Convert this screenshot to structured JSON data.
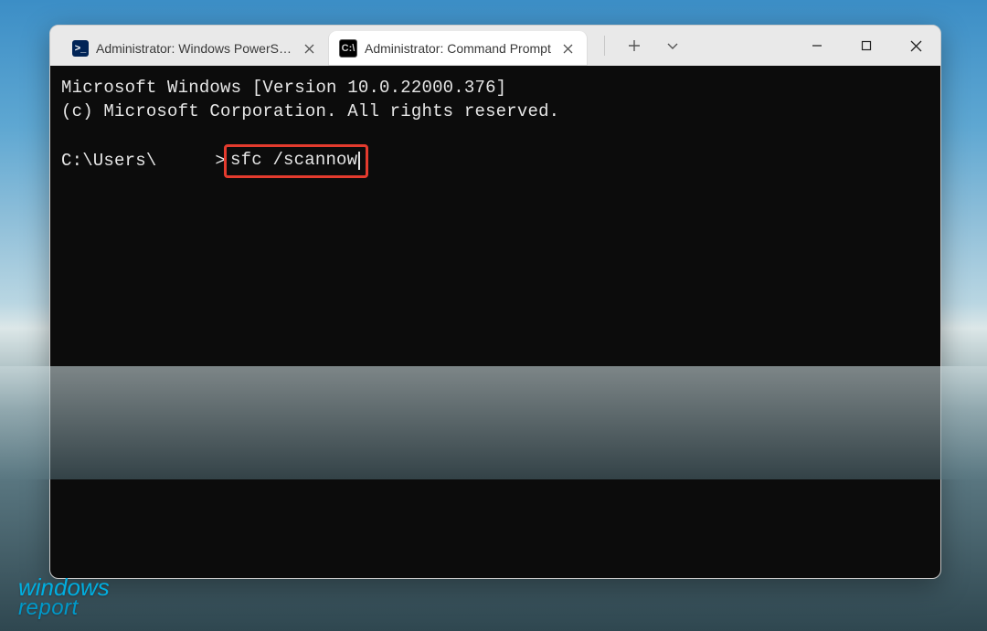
{
  "watermark": {
    "line1": "windows",
    "line2": "report"
  },
  "titlebar": {
    "tabs": [
      {
        "label": "Administrator: Windows PowerShell",
        "icon": "powershell-icon",
        "active": false
      },
      {
        "label": "Administrator: Command Prompt",
        "icon": "cmd-icon",
        "active": true
      }
    ],
    "new_tab_tooltip": "New tab",
    "dropdown_tooltip": "Open a new tab dropdown"
  },
  "window_controls": {
    "minimize_tooltip": "Minimize",
    "maximize_tooltip": "Maximize",
    "close_tooltip": "Close"
  },
  "terminal": {
    "banner_line1": "Microsoft Windows [Version 10.0.22000.376]",
    "banner_line2": "(c) Microsoft Corporation. All rights reserved.",
    "prompt_prefix": "C:\\Users\\",
    "prompt_suffix": ">",
    "typed_command": "sfc /scannow"
  },
  "highlight": {
    "color": "#e43b2e",
    "target": "typed_command"
  }
}
